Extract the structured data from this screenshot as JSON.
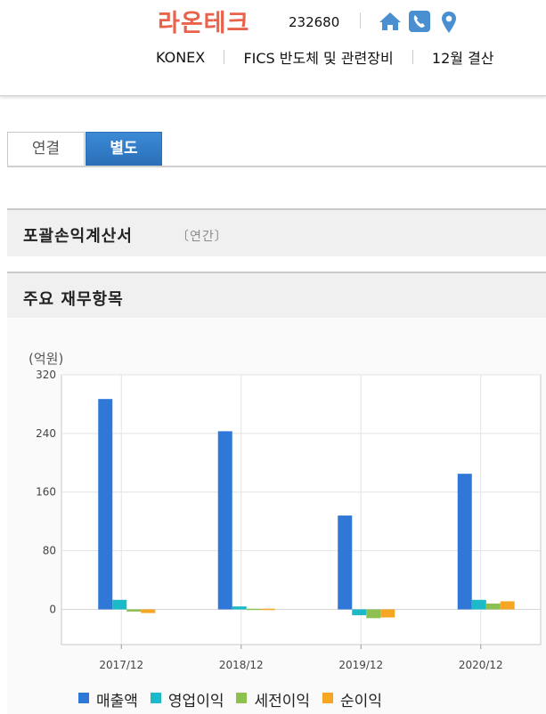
{
  "header": {
    "company_name": "라온테크",
    "stock_code": "232680",
    "market": "KONEX",
    "sector": "FICS 반도체 및 관련장비",
    "fiscal": "12월 결산",
    "icons": [
      "home-icon",
      "phone-icon",
      "pin-icon"
    ],
    "brand_color": "#e8624c",
    "icon_color": "#4a8fd0"
  },
  "tabs": [
    {
      "label": "연결",
      "active": false
    },
    {
      "label": "별도",
      "active": true
    }
  ],
  "sections": {
    "income_statement": {
      "title": "포괄손익계산서",
      "sub": "〔연간〕"
    },
    "major_items": {
      "title": "주요 재무항목"
    }
  },
  "chart_data": {
    "type": "bar",
    "unit_label": "(억원)",
    "categories": [
      "2017/12",
      "2018/12",
      "2019/12",
      "2020/12"
    ],
    "series": [
      {
        "name": "매출액",
        "color": "#2f78d8",
        "values": [
          287,
          243,
          128,
          185
        ]
      },
      {
        "name": "영업이익",
        "color": "#1cb9c9",
        "values": [
          13,
          4,
          -8,
          13
        ]
      },
      {
        "name": "세전이익",
        "color": "#8cc152",
        "values": [
          -3,
          0,
          -12,
          8
        ]
      },
      {
        "name": "순이익",
        "color": "#f5a623",
        "values": [
          -5,
          0,
          -11,
          11
        ]
      }
    ],
    "yticks": [
      0,
      80,
      160,
      240,
      320
    ],
    "ylim": [
      -48,
      320
    ],
    "grid": true,
    "legend": "bottom"
  }
}
